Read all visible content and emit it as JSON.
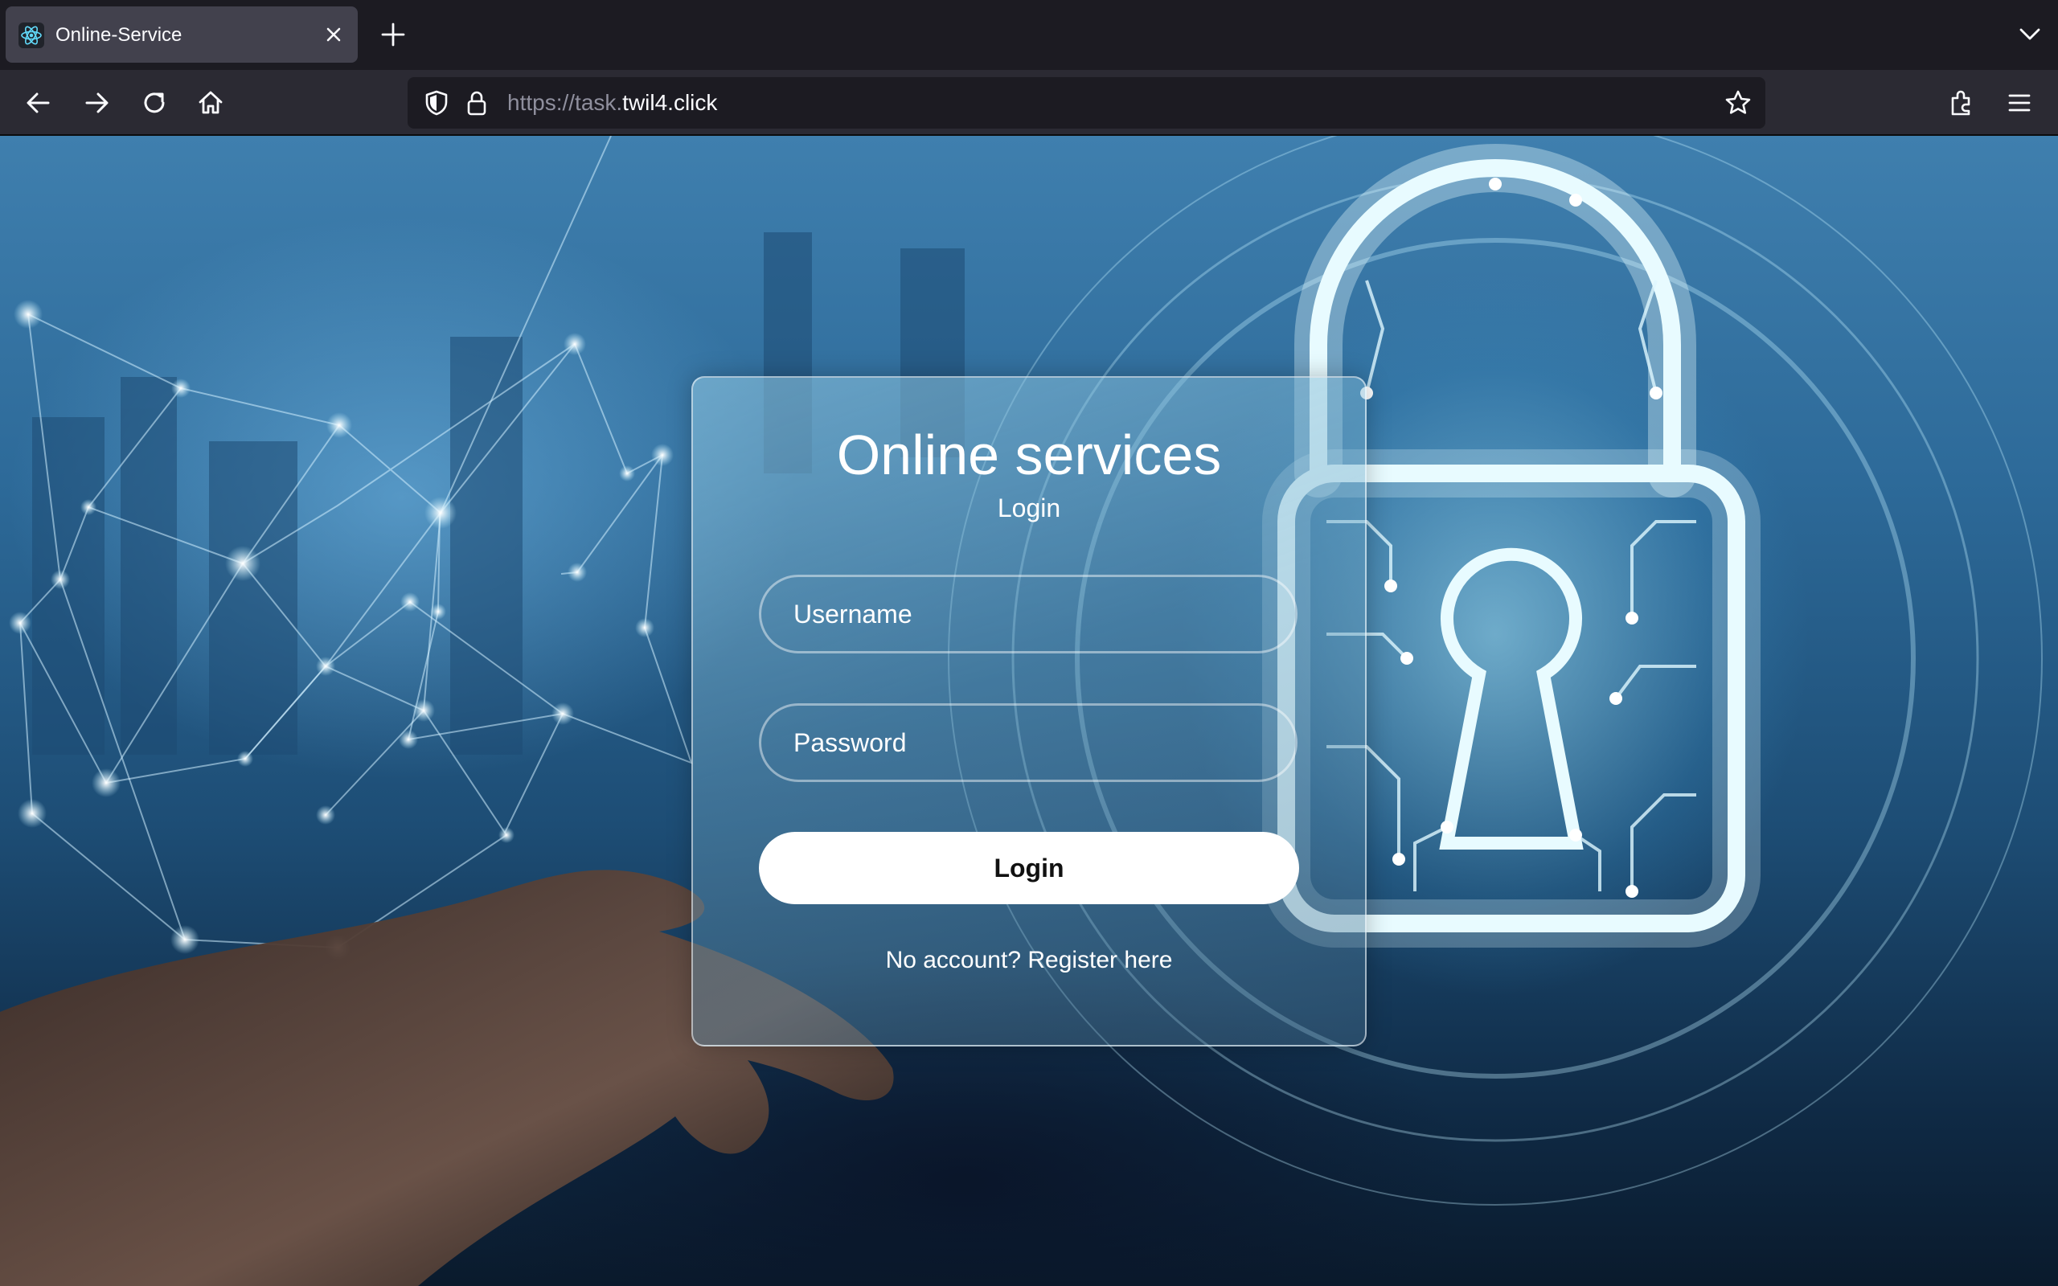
{
  "browser": {
    "tab": {
      "title": "Online-Service",
      "favicon": "react-atom-icon"
    },
    "url": {
      "scheme_and_sub": "https://task.",
      "host": "twil4.click"
    },
    "icons": {
      "tab_close": "close-icon",
      "new_tab": "plus-icon",
      "list_tabs": "chevron-down-icon",
      "back": "arrow-left-icon",
      "forward": "arrow-right-icon",
      "reload": "reload-icon",
      "home": "home-icon",
      "tracking": "shield-icon",
      "security": "lock-icon",
      "bookmark": "star-icon",
      "extensions": "puzzle-icon",
      "menu": "hamburger-icon"
    }
  },
  "login": {
    "title": "Online services",
    "subtitle": "Login",
    "username_placeholder": "Username",
    "password_placeholder": "Password",
    "login_button": "Login",
    "register_text": "No account? Register here"
  },
  "colors": {
    "chrome_dark": "#1c1b22",
    "toolbar": "#2b2a33",
    "tab_active": "#42414d",
    "text_light": "#fbfbfe",
    "button_bg": "#ffffff"
  }
}
